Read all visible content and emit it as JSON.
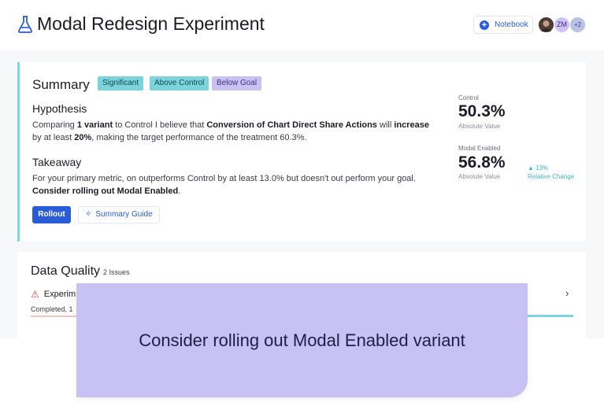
{
  "header": {
    "title": "Modal Redesign Experiment",
    "icon": "flask-icon",
    "notebook_label": "Notebook",
    "avatars": [
      {
        "initials": ""
      },
      {
        "initials": "ZM"
      },
      {
        "initials": "+2"
      }
    ]
  },
  "summary": {
    "title": "Summary",
    "badges": [
      "Significant",
      "Above Control",
      "Below Goal"
    ],
    "hypothesis_title": "Hypothesis",
    "hypothesis": {
      "p1": "Comparing ",
      "b1": "1 variant",
      "p2": " to Control I believe that ",
      "b2": "Conversion of Chart Direct Share Actions",
      "p3": " will ",
      "b3": "increase",
      "p4": " by at least ",
      "b4": "20%",
      "p5": ", making the target performance of the treatment 60.3%."
    },
    "takeaway_title": "Takeaway",
    "takeaway": {
      "p1": "For your primary metric, on outperforms Control by at least 13.0% but doesn't out perform your goal. ",
      "b1": "Consider rolling out Modal Enabled",
      "p2": "."
    },
    "rollout_label": "Rollout",
    "guide_label": "Summary Guide",
    "metrics": {
      "control_label": "Control",
      "control_value": "50.3%",
      "control_sub": "Absolute Value",
      "variant_label": "Modal Enabled",
      "variant_value": "56.8%",
      "variant_sub": "Absolute Value",
      "change_value": "▲ 13%",
      "change_label": "Relative Change"
    }
  },
  "data_quality": {
    "title": "Data Quality",
    "issues": "2 Issues",
    "row_label": "Experim",
    "row_sub": "Completed, 1"
  },
  "overlay": {
    "text": "Consider rolling out Modal Enabled variant"
  },
  "colors": {
    "accent": "#2a5cd8",
    "teal": "#7fd6e2",
    "lavender": "#c7c1f4"
  }
}
